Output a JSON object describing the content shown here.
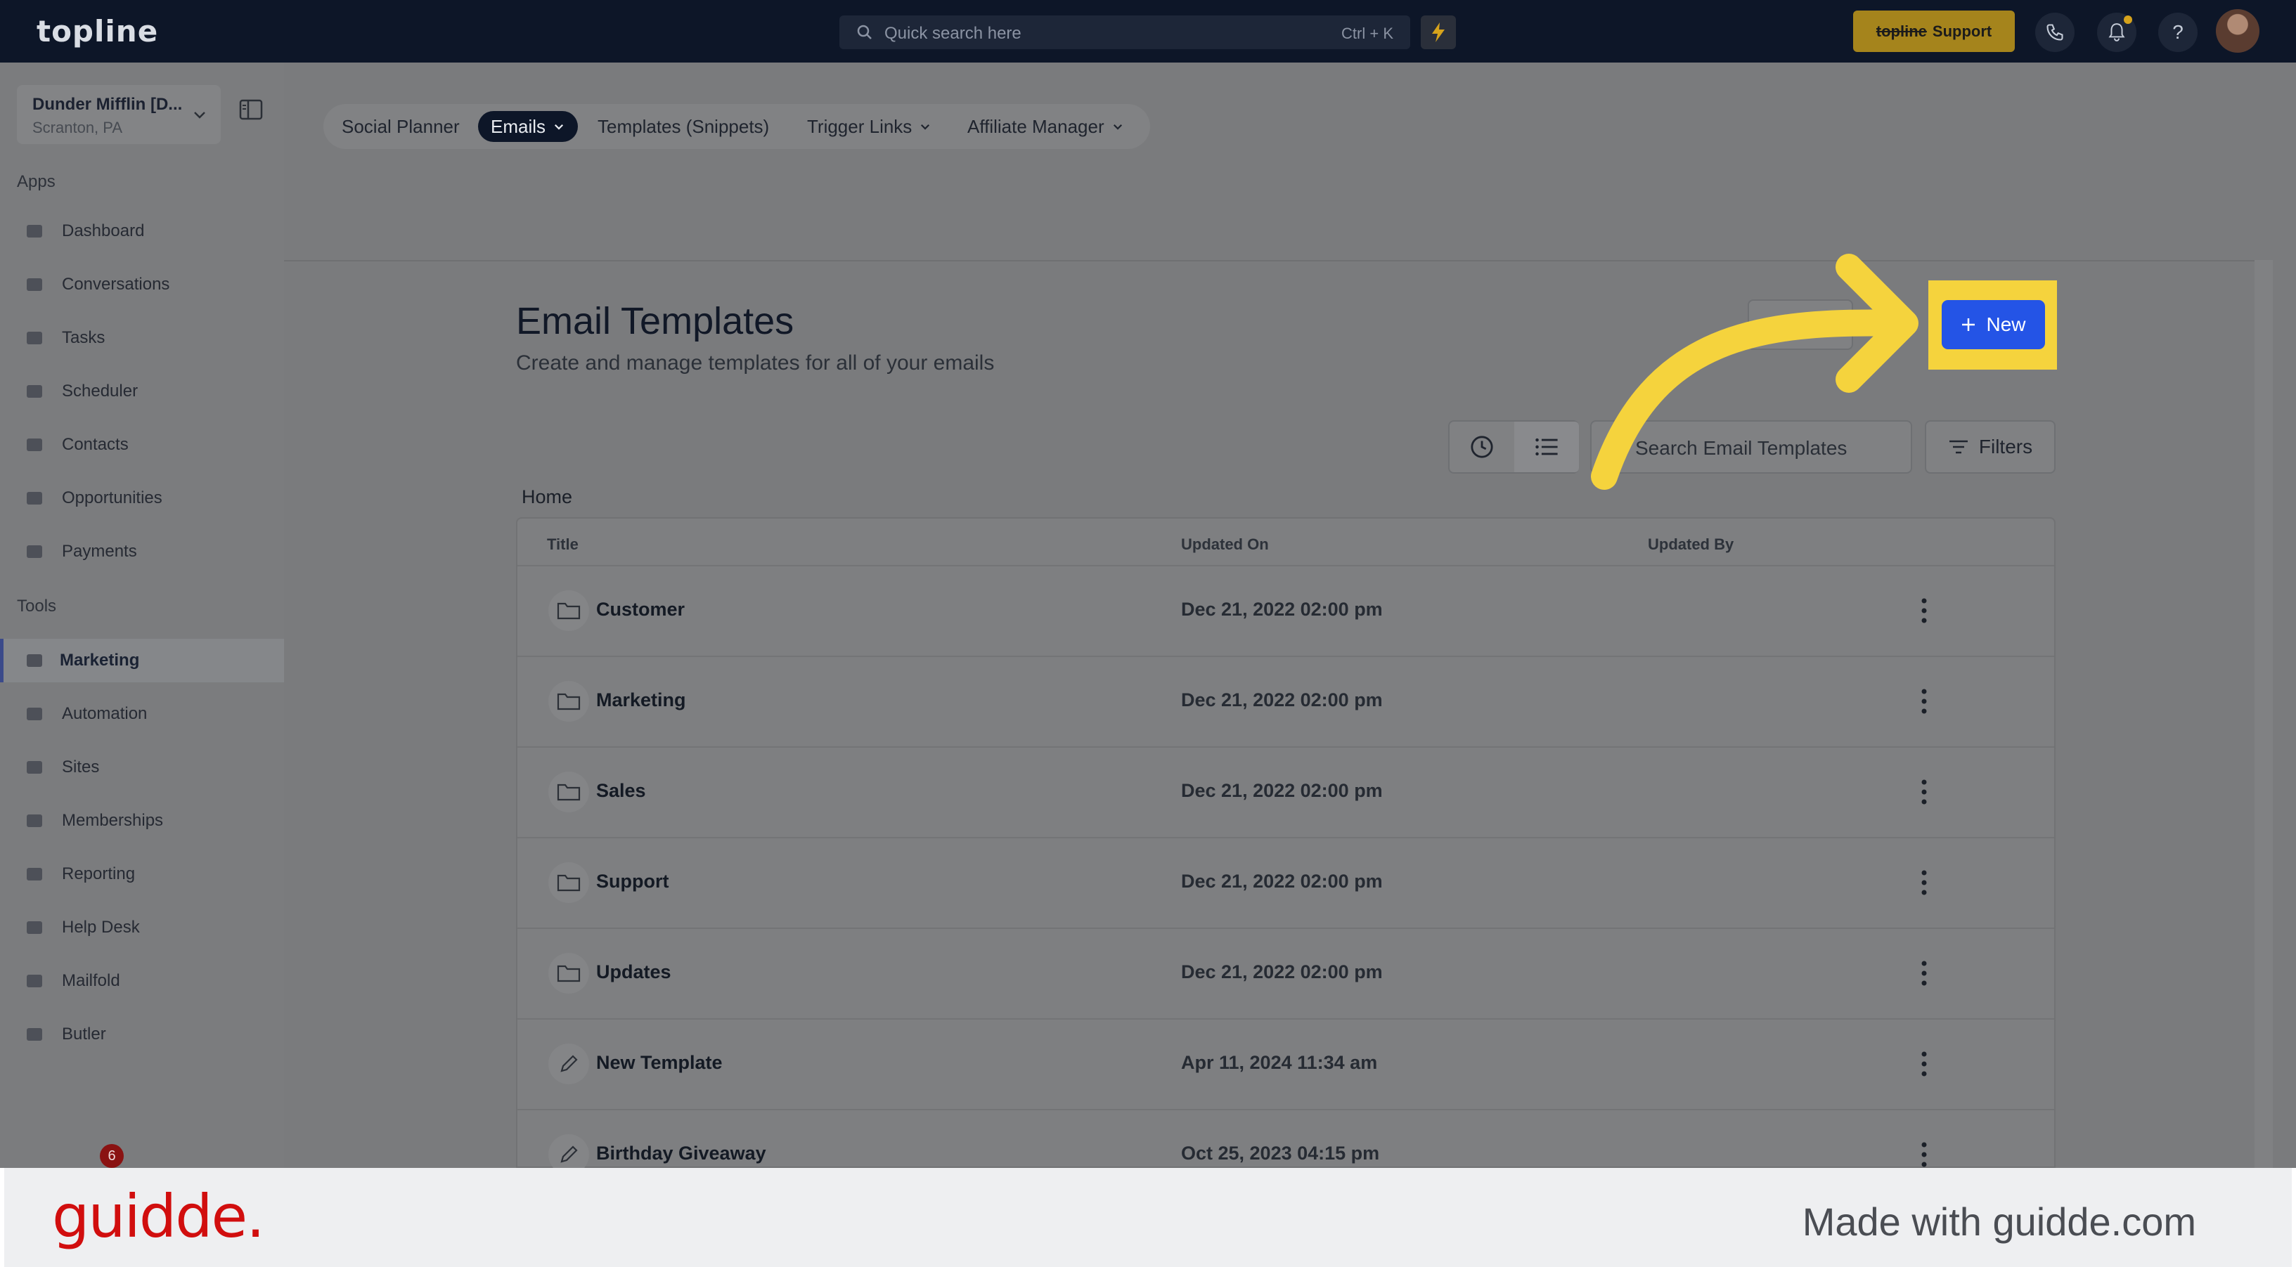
{
  "topbar": {
    "logo": "topline",
    "search_placeholder": "Quick search here",
    "search_shortcut": "Ctrl + K",
    "support_brand": "topline",
    "support_label": "Support",
    "help_glyph": "?"
  },
  "sidebar": {
    "account_name": "Dunder Mifflin [D...",
    "account_location": "Scranton, PA",
    "apps_label": "Apps",
    "apps": [
      {
        "label": "Dashboard",
        "icon": "dashboard-icon"
      },
      {
        "label": "Conversations",
        "icon": "chat-icon"
      },
      {
        "label": "Tasks",
        "icon": "clipboard-icon"
      },
      {
        "label": "Scheduler",
        "icon": "calendar-icon"
      },
      {
        "label": "Contacts",
        "icon": "person-icon"
      },
      {
        "label": "Opportunities",
        "icon": "target-icon"
      },
      {
        "label": "Payments",
        "icon": "card-icon"
      }
    ],
    "tools_label": "Tools",
    "tools": [
      {
        "label": "Marketing",
        "icon": "megaphone-icon",
        "active": true
      },
      {
        "label": "Automation",
        "icon": "gears-icon"
      },
      {
        "label": "Sites",
        "icon": "globe-icon"
      },
      {
        "label": "Memberships",
        "icon": "group-icon"
      },
      {
        "label": "Reporting",
        "icon": "pie-chart-icon"
      },
      {
        "label": "Help Desk",
        "icon": "help-circle-icon"
      },
      {
        "label": "Mailfold",
        "icon": "mail-box-icon"
      },
      {
        "label": "Butler",
        "icon": "bell-tray-icon"
      }
    ],
    "badge_count": "6"
  },
  "subnav": {
    "tabs": [
      {
        "label": "Social Planner"
      },
      {
        "label": "Emails",
        "active": true
      },
      {
        "label": "Templates (Snippets)"
      },
      {
        "label": "Trigger Links"
      },
      {
        "label": "Affiliate Manager"
      }
    ]
  },
  "main": {
    "title": "Email Templates",
    "subtitle": "Create and manage templates for all of your emails",
    "new_button": "New",
    "search_placeholder": "Search Email Templates",
    "filters_label": "Filters",
    "breadcrumb": "Home",
    "columns": [
      "Title",
      "Updated On",
      "Updated By"
    ],
    "rows": [
      {
        "title": "Customer",
        "updated_on": "Dec 21, 2022 02:00 pm",
        "type": "folder"
      },
      {
        "title": "Marketing",
        "updated_on": "Dec 21, 2022 02:00 pm",
        "type": "folder"
      },
      {
        "title": "Sales",
        "updated_on": "Dec 21, 2022 02:00 pm",
        "type": "folder"
      },
      {
        "title": "Support",
        "updated_on": "Dec 21, 2022 02:00 pm",
        "type": "folder"
      },
      {
        "title": "Updates",
        "updated_on": "Dec 21, 2022 02:00 pm",
        "type": "folder"
      },
      {
        "title": "New Template",
        "updated_on": "Apr 11, 2024 11:34 am",
        "type": "template"
      },
      {
        "title": "Birthday Giveaway",
        "updated_on": "Oct 25, 2023 04:15 pm",
        "type": "template"
      }
    ]
  },
  "footer": {
    "brand": "guidde.",
    "made_with": "Made with guidde.com"
  },
  "colors": {
    "accent": "#2454e6",
    "highlight": "#f5d33d",
    "topbar": "#0d1628",
    "brand_red": "#d10e0e"
  }
}
